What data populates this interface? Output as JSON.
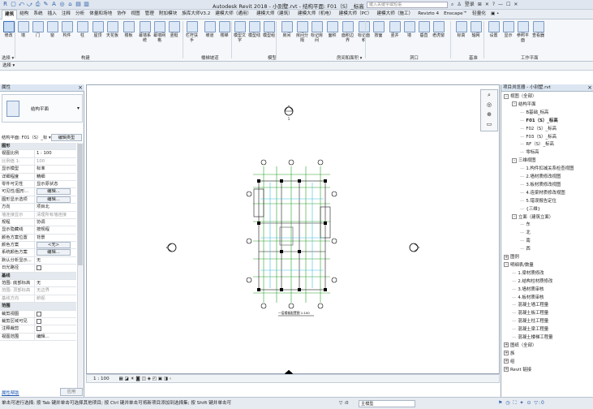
{
  "app": {
    "window_title": "Autodesk Revit 2018 -  小别墅.rvt - 结构平面: F01（S）_标高",
    "search_placeholder": "键入关键字或短语",
    "user": "登录",
    "help": "?"
  },
  "qat": [
    "R",
    "▢",
    "⤺",
    "⤻",
    "⎙",
    "✎",
    "A",
    "◎",
    "⌂",
    "▤",
    "▥"
  ],
  "tabs": [
    "建筑",
    "结构",
    "系统",
    "插入",
    "注释",
    "分析",
    "体量和场地",
    "协作",
    "视图",
    "管理",
    "附加模块",
    "族库大师V3.2",
    "建模大师（通用）",
    "建模大师（建筑）",
    "建模大师（机电）",
    "建模大师（PC）",
    "建模大师（施工）",
    "Revizto 4",
    "Enscape™",
    "轻量化",
    "▣ •"
  ],
  "ribbon": {
    "buttons": [
      "修改",
      "墙",
      "门",
      "窗",
      "构件",
      "柱",
      "屋顶",
      "天花板",
      "楼板",
      "幕墙系统",
      "幕墙网格",
      "竖梃",
      "栏杆扶手",
      "坡道",
      "楼梯",
      "模型文字",
      "模型线",
      "模型组",
      "房间",
      "房间分隔",
      "标记房间",
      "面积",
      "面积边界",
      "标记面积",
      "按面",
      "竖井",
      "墙",
      "垂直",
      "老虎窗",
      "标高",
      "轴网",
      "设置",
      "显示",
      "参照平面",
      "查看器"
    ],
    "groups": [
      "选择 ▾",
      "构建",
      "楼梯坡道",
      "模型",
      "房间和面积 ▾",
      "洞口",
      "基准",
      "工作平面"
    ]
  },
  "select_label": "选择 ▾",
  "properties": {
    "title": "属性",
    "type_name": "结构平面",
    "instance": "结构平面: F01（S）_标",
    "edit_type": "编辑类型",
    "rows": [
      {
        "k": "图形",
        "cat": true
      },
      {
        "k": "视图比例",
        "v": "1 : 100"
      },
      {
        "k": "比例值 1:",
        "v": "100",
        "dim": true
      },
      {
        "k": "显示模型",
        "v": "标准"
      },
      {
        "k": "详细程度",
        "v": "精细"
      },
      {
        "k": "零件可见性",
        "v": "显示原状态"
      },
      {
        "k": "可见性/图形...",
        "v": "编辑...",
        "btn": true
      },
      {
        "k": "图形显示选项",
        "v": "编辑...",
        "btn": true
      },
      {
        "k": "方向",
        "v": "项目北"
      },
      {
        "k": "墙连接显示",
        "v": "清理所有墙连接",
        "dim": true
      },
      {
        "k": "规程",
        "v": "协调"
      },
      {
        "k": "显示隐藏线",
        "v": "按规程"
      },
      {
        "k": "颜色方案位置",
        "v": "背景"
      },
      {
        "k": "颜色方案",
        "v": "<无>",
        "btn": true
      },
      {
        "k": "系统颜色方案",
        "v": "编辑...",
        "btn": true
      },
      {
        "k": "默认分析显示...",
        "v": "无"
      },
      {
        "k": "日光路径",
        "v": "",
        "check": true
      },
      {
        "k": "基线",
        "cat": true
      },
      {
        "k": "范围: 底部标高",
        "v": "无"
      },
      {
        "k": "范围: 顶部标高",
        "v": "无边界",
        "dim": true
      },
      {
        "k": "基线方向",
        "v": "俯视",
        "dim": true
      },
      {
        "k": "范围",
        "cat": true
      },
      {
        "k": "裁剪视图",
        "v": "",
        "check": true
      },
      {
        "k": "裁剪区域可见",
        "v": "",
        "check": true
      },
      {
        "k": "注释裁剪",
        "v": "",
        "check": true
      },
      {
        "k": "视图范围",
        "v": "编辑..."
      }
    ],
    "help_link": "属性帮助",
    "apply": "应用"
  },
  "canvas": {
    "markers": [
      "1",
      "1",
      "1",
      "1"
    ],
    "drawing_title": "一层楼板配置图 1:100"
  },
  "view_control": {
    "scale": "1 : 100",
    "icons": "▦ ◪ ☀ ◙ ◫ ◈ ◰ ▣ ◨ ‹"
  },
  "project_browser": {
    "title": "项目浏览器 - 小别墅.rvt",
    "items": [
      {
        "t": "视图（全部）",
        "lv": 0,
        "e": "-"
      },
      {
        "t": "结构平面",
        "lv": 1,
        "e": "-"
      },
      {
        "t": "B基础_标高",
        "lv": 2
      },
      {
        "t": "F01（S）_标高",
        "lv": 2,
        "bold": true
      },
      {
        "t": "F02（S）_标高",
        "lv": 2
      },
      {
        "t": "F03（S）_标高",
        "lv": 2
      },
      {
        "t": "RF（S）_标高",
        "lv": 2
      },
      {
        "t": "零标高",
        "lv": 2
      },
      {
        "t": "三维视图",
        "lv": 1,
        "e": "-"
      },
      {
        "t": "1.构件扣减关系检查视图",
        "lv": 2
      },
      {
        "t": "2.墙材质修改视图",
        "lv": 2
      },
      {
        "t": "3.板材质修改视图",
        "lv": 2
      },
      {
        "t": "4.连梁材质修改视图",
        "lv": 2
      },
      {
        "t": "5.错误报告定位",
        "lv": 2
      },
      {
        "t": "{三维}",
        "lv": 2
      },
      {
        "t": "立面（建筑立面）",
        "lv": 1,
        "e": "-"
      },
      {
        "t": "东",
        "lv": 2
      },
      {
        "t": "北",
        "lv": 2
      },
      {
        "t": "南",
        "lv": 2
      },
      {
        "t": "西",
        "lv": 2
      },
      {
        "t": "图例",
        "lv": 0,
        "e": "+"
      },
      {
        "t": "明细表/数量",
        "lv": 0,
        "e": "-"
      },
      {
        "t": "1.梁材质修改",
        "lv": 1
      },
      {
        "t": "2.结构柱材质修改",
        "lv": 1
      },
      {
        "t": "3.墙材质审核",
        "lv": 1
      },
      {
        "t": "4.板材质审核",
        "lv": 1
      },
      {
        "t": "混凝土墙工程量",
        "lv": 1
      },
      {
        "t": "混凝土板工程量",
        "lv": 1
      },
      {
        "t": "混凝土柱工程量",
        "lv": 1
      },
      {
        "t": "混凝土梁工程量",
        "lv": 1
      },
      {
        "t": "混凝土楼梯工程量",
        "lv": 1
      },
      {
        "t": "图纸（全部）",
        "lv": 0,
        "e": "+"
      },
      {
        "t": "族",
        "lv": 0,
        "e": "+"
      },
      {
        "t": "组",
        "lv": 0,
        "e": "+"
      },
      {
        "t": "Revit 链接",
        "lv": 0,
        "e": "+"
      }
    ]
  },
  "status": {
    "text": "单击可进行选择; 按 Tab 键并单击可选择其他项目; 按 Ctrl 键并单击可将新项目添加到选择集; 按 Shift 键并单击可",
    "filter": "▽ :0",
    "workset": "主模型",
    "icons": "⚑ ◷ ⛶ ✦ ⊙ ▽:0"
  }
}
